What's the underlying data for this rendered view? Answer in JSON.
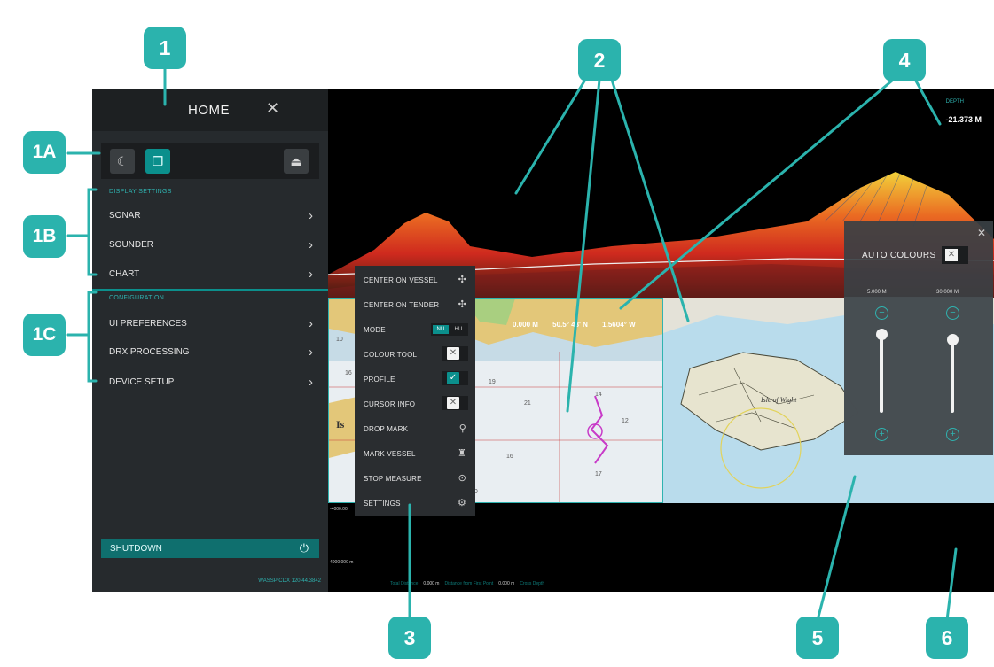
{
  "menu": {
    "title": "HOME",
    "close_icon": "close-icon",
    "quickbar": [
      "night-mode-icon",
      "window-mode-icon",
      "vessel-icon"
    ],
    "display_settings_header": "DISPLAY SETTINGS",
    "display_items": [
      {
        "label": "SONAR"
      },
      {
        "label": "SOUNDER"
      },
      {
        "label": "CHART"
      }
    ],
    "configuration_header": "CONFIGURATION",
    "config_items": [
      {
        "label": "UI PREFERENCES"
      },
      {
        "label": "DRX PROCESSING"
      },
      {
        "label": "DEVICE SETUP"
      }
    ],
    "shutdown": "SHUTDOWN",
    "version": "WASSP CDX 120.44.3842"
  },
  "context_menu": {
    "items": [
      {
        "label": "CENTER ON VESSEL"
      },
      {
        "label": "CENTER ON TENDER"
      },
      {
        "label": "MODE",
        "options": [
          "NU",
          "HU"
        ],
        "selected": "NU"
      },
      {
        "label": "COLOUR TOOL",
        "checked": false
      },
      {
        "label": "PROFILE",
        "checked": true
      },
      {
        "label": "CURSOR INFO",
        "checked": false
      },
      {
        "label": "DROP MARK"
      },
      {
        "label": "MARK VESSEL"
      },
      {
        "label": "STOP MEASURE"
      },
      {
        "label": "SETTINGS"
      }
    ]
  },
  "chart": {
    "coords": [
      "0.000 M",
      "50.5° 43' N",
      "1.5604° W"
    ],
    "island_label": "Isle of Wight"
  },
  "colours_panel": {
    "auto_colours": "AUTO COLOURS",
    "auto_checked": false,
    "range_min": "5.000 M",
    "range_max": "30.000 M",
    "slider_left": 0.9,
    "slider_right": 0.85
  },
  "sonar": {
    "depth_label": "DEPTH",
    "depth_value": "-21.373 M",
    "scale_top": "-4000.00",
    "scale_bottom": "4000.000 m",
    "status": {
      "trip_label": "Total Distance",
      "trip_value": "0.000 m",
      "first_label": "Distance from First Point",
      "first_value": "0.000 m",
      "mode_label": "Cross Depth"
    }
  },
  "callouts": [
    "1",
    "1A",
    "1B",
    "1C",
    "2",
    "3",
    "4",
    "5",
    "6"
  ],
  "colors": {
    "accent": "#2bb3ad",
    "menu_bg": "#262a2d",
    "screen_bg": "#000000"
  }
}
